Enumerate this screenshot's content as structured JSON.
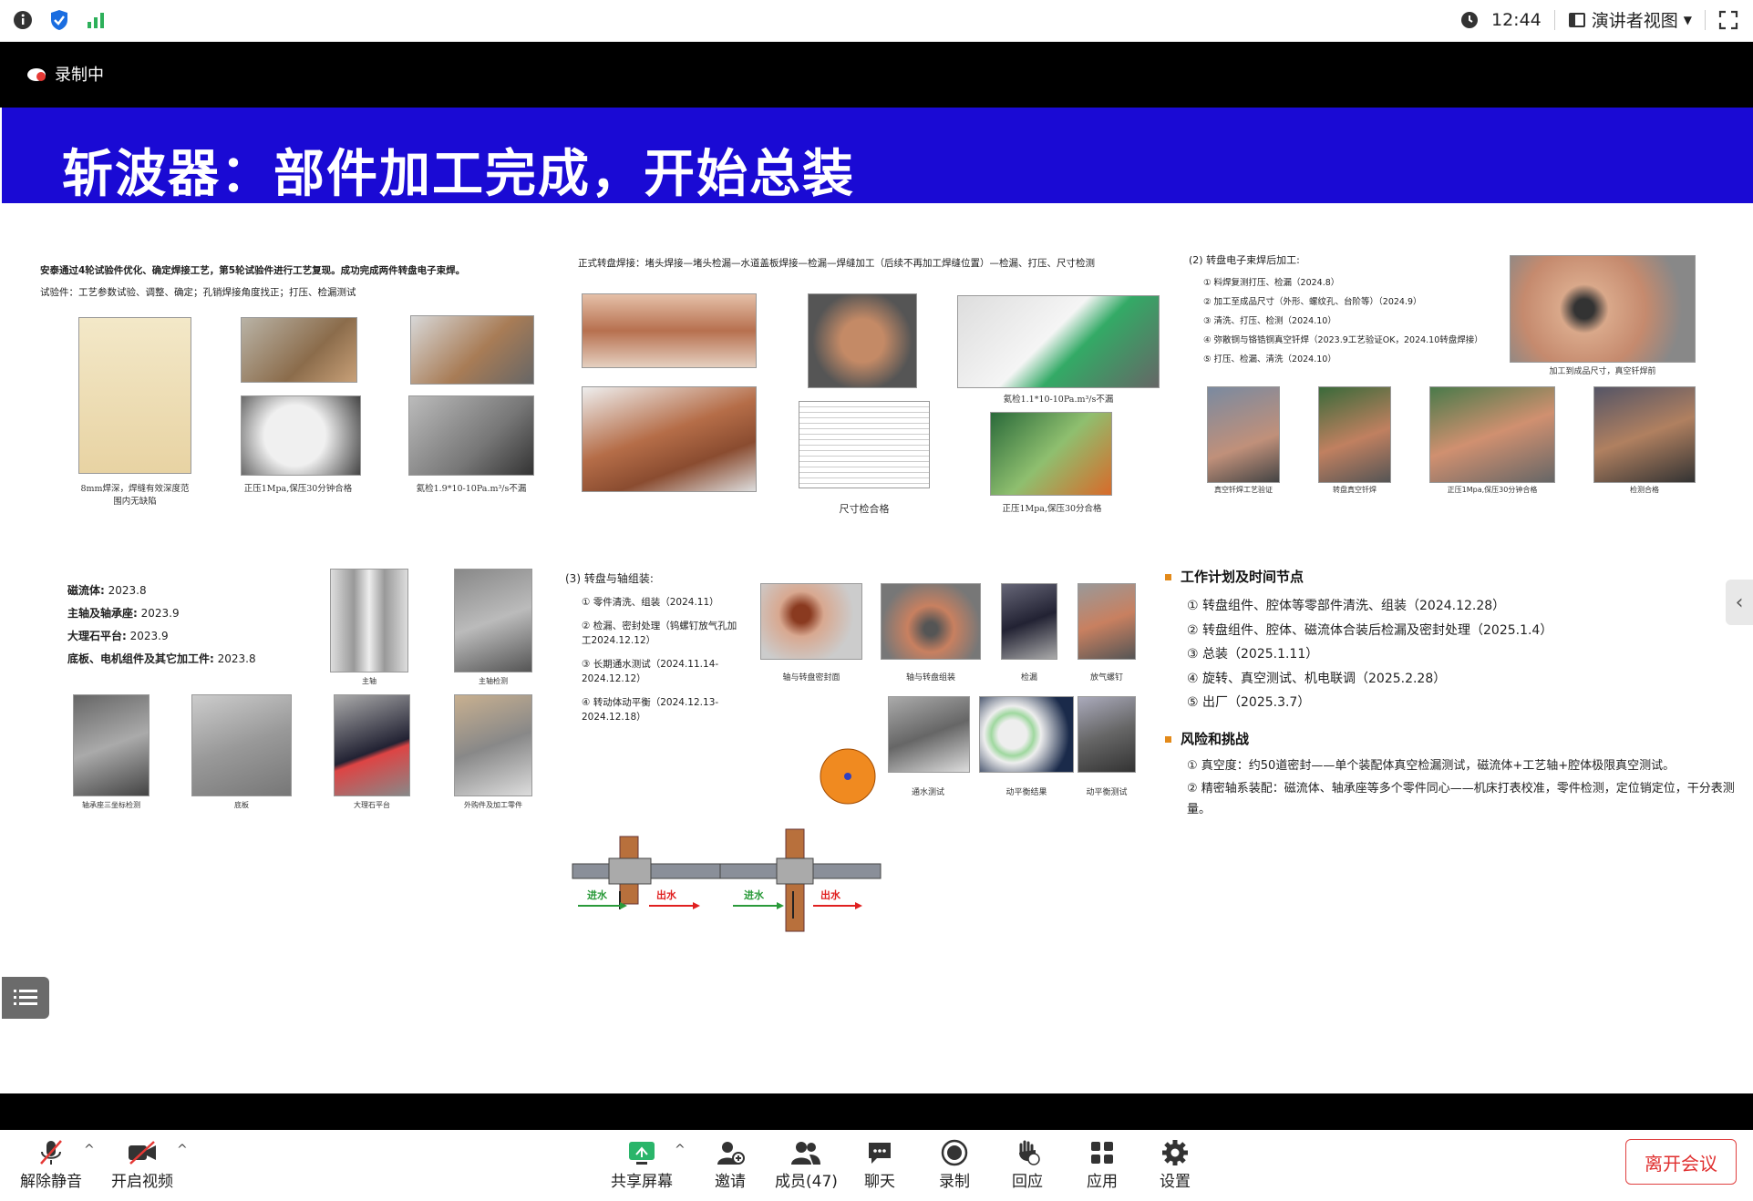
{
  "topbar": {
    "time": "12:44",
    "view_label": "演讲者视图"
  },
  "recording": {
    "label": "录制中"
  },
  "slide": {
    "title": "斩波器：部件加工完成，开始总装",
    "s1": {
      "intro": "安泰通过4轮试验件优化、确定焊接工艺，第5轮试验件进行工艺复现。成功完成两件转盘电子束焊。",
      "sub": "试验件：工艺参数试验、调整、确定；孔销焊接角度找正；打压、检漏测试",
      "cap1": "8mm焊深，焊缝有效深度范围内无缺陷",
      "cap2": "正压1Mpa,保压30分钟合格",
      "cap3": "氦检1.9*10-10Pa.m³/s不漏"
    },
    "s2": {
      "heading": "正式转盘焊接：堵头焊接—堵头检漏—水道盖板焊接—检漏—焊缝加工（后续不再加工焊缝位置）—检漏、打压、尺寸检测",
      "cap_size": "尺寸检合格",
      "cap_he": "氦检1.1*10-10Pa.m³/s不漏",
      "cap_press": "正压1Mpa,保压30分合格"
    },
    "s3": {
      "heading": "(2) 转盘电子束焊后加工:",
      "items": [
        "① 料焊复测打压、检漏（2024.8）",
        "② 加工至成品尺寸（外形、螺纹孔、台阶等）（2024.9）",
        "③ 清洗、打压、检测（2024.10）",
        "④ 弥散铜与铬锆铜真空钎焊（2023.9工艺验证OK，2024.10转盘焊接）",
        "⑤ 打压、检漏、清洗（2024.10）"
      ],
      "cap_top": "加工到成品尺寸，真空钎焊前",
      "caps": [
        "真空钎焊工艺验证",
        "转盘真空钎焊",
        "正压1Mpa,保压30分钟合格",
        "检测合格"
      ]
    },
    "s4": {
      "lines": [
        {
          "k": "磁流体:",
          "v": "2023.8"
        },
        {
          "k": "主轴及轴承座:",
          "v": "2023.9"
        },
        {
          "k": "大理石平台:",
          "v": "2023.9"
        },
        {
          "k": "底板、电机组件及其它加工件:",
          "v": "2023.8"
        }
      ],
      "caps": [
        "主轴",
        "主轴检测",
        "轴承座三坐标检测",
        "底板",
        "大理石平台",
        "外购件及加工零件"
      ]
    },
    "s5": {
      "heading": "(3) 转盘与轴组装:",
      "items": [
        "① 零件清洗、组装（2024.11）",
        "② 检漏、密封处理（钨螺钉放气孔加工2024.12.12）",
        "③ 长期通水测试（2024.11.14-2024.12.12）",
        "④ 转动体动平衡（2024.12.13-2024.12.18）"
      ],
      "in_label": "进水",
      "out_label": "出水",
      "caps": [
        "轴与转盘密封面",
        "轴与转盘组装",
        "检漏",
        "放气螺钉",
        "通水测试",
        "动平衡结果",
        "动平衡测试"
      ]
    },
    "s6": {
      "plan_heading": "工作计划及时间节点",
      "plan": [
        "① 转盘组件、腔体等零部件清洗、组装（2024.12.28）",
        "② 转盘组件、腔体、磁流体合装后检漏及密封处理（2025.1.4）",
        "③ 总装（2025.1.11）",
        "④ 旋转、真空测试、机电联调（2025.2.28）",
        "⑤ 出厂（2025.3.7）"
      ],
      "risk_heading": "风险和挑战",
      "risks": [
        "① 真空度：约50道密封——单个装配体真空检漏测试，磁流体+工艺轴+腔体极限真空测试。",
        "② 精密轴系装配：磁流体、轴承座等多个零件同心——机床打表校准，零件检测，定位销定位，干分表测量。"
      ]
    }
  },
  "toolbar": {
    "mute": "解除静音",
    "video": "开启视频",
    "share": "共享屏幕",
    "invite": "邀请",
    "members": "成员(47)",
    "chat": "聊天",
    "record": "录制",
    "react": "回应",
    "apps": "应用",
    "settings": "设置",
    "leave": "离开会议"
  }
}
